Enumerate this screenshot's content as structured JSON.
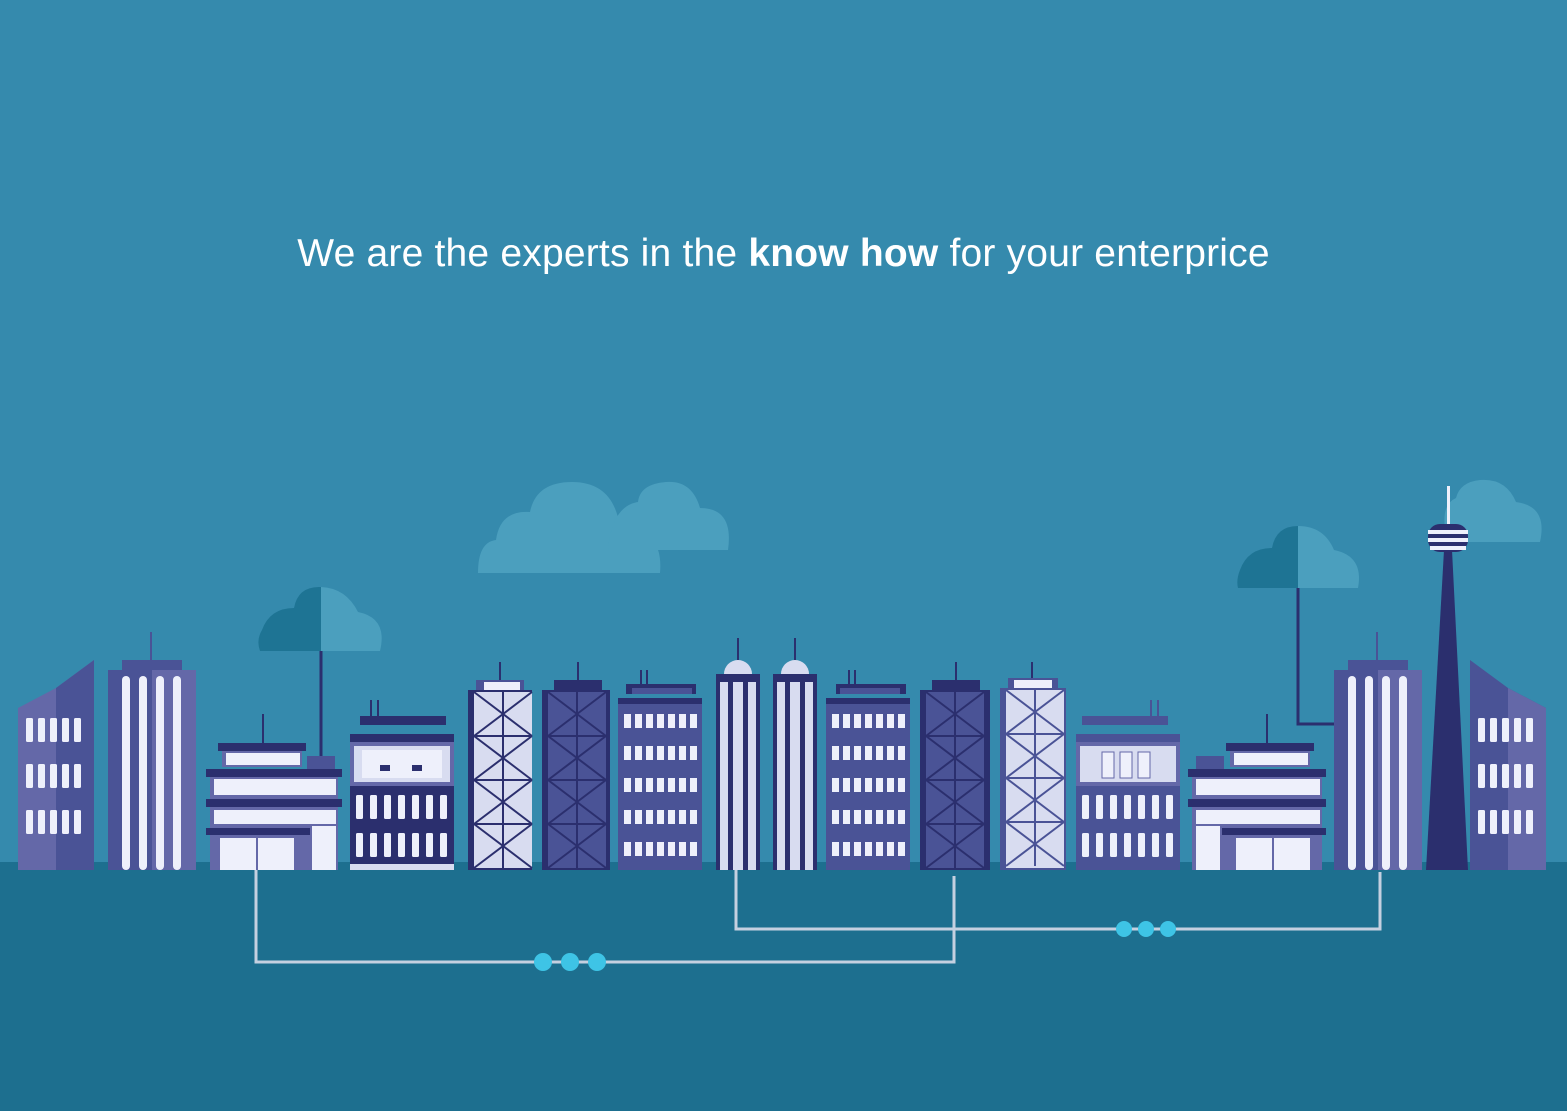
{
  "headline": {
    "prefix": "We are the experts in the ",
    "emphasis": "know how",
    "suffix": " for your enterprice"
  },
  "colors": {
    "sky": "#358aad",
    "ground": "#1d6f8f",
    "cloud_light": "#4b9fbe",
    "cloud_dark": "#1e7494",
    "building_navy": "#2b2f6e",
    "building_mid": "#4a5396",
    "building_light": "#6468a8",
    "window_white": "#eef0fb",
    "connector_line": "#c5d0e0",
    "node_dot": "#3ec4e6"
  },
  "scene": {
    "subject": "city skyline illustration with connected buildings",
    "icons": [
      "cloud-icon",
      "tv-tower-icon",
      "antenna-icon",
      "network-node-icon"
    ]
  }
}
